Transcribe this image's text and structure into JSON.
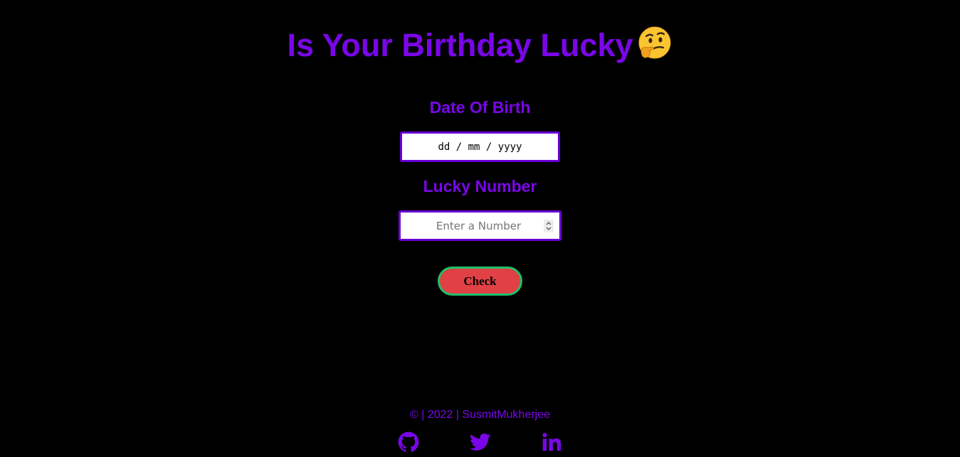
{
  "colors": {
    "background": "#000000",
    "accent": "#7a06e8",
    "input_border": "#6a00d4",
    "button_fill": "#e04145",
    "button_border": "#1fc06a"
  },
  "header": {
    "title": "Is Your Birthday Lucky",
    "emoji_icon": "thinking-face-icon"
  },
  "form": {
    "dob_label": "Date Of Birth",
    "dob_value": "dd / mm / yyyy",
    "lucky_label": "Lucky Number",
    "lucky_placeholder": "Enter a Number",
    "check_label": "Check"
  },
  "footer": {
    "credit": "© | 2022 | SusmitMukherjee",
    "links": [
      {
        "icon": "github-icon"
      },
      {
        "icon": "twitter-icon"
      },
      {
        "icon": "linkedin-icon"
      }
    ]
  }
}
